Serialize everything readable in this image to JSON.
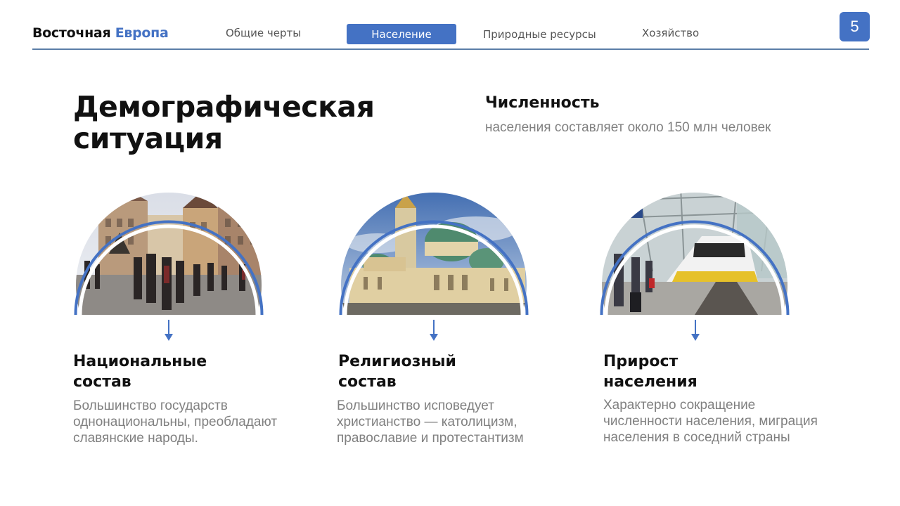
{
  "header": {
    "brand_main": "Восточная",
    "brand_accent": "Европа",
    "nav": [
      "Общие черты",
      "Население",
      "Природные ресурсы",
      "Хозяйство"
    ],
    "active_index": 1,
    "page_number": "5"
  },
  "title": {
    "line1": "Демографическая",
    "line2": "ситуация"
  },
  "stat": {
    "heading": "Численность",
    "text": "населения составляет около 150 млн человек"
  },
  "columns": [
    {
      "image": "old-town-square-photo",
      "heading1": "Национальные",
      "heading2": "состав",
      "lines": [
        "Большинство государств",
        "однонациональны, преобладают",
        "славянские народы."
      ]
    },
    {
      "image": "cathedral-photo",
      "heading1": "Религиозный",
      "heading2": "состав",
      "lines": [
        "Большинство исповедует",
        "христианство — католицизм,",
        "православие и протестантизм"
      ]
    },
    {
      "image": "train-station-photo",
      "heading1": "Прирост",
      "heading2": "населения",
      "lines": [
        "Характерно сокращение",
        "численности населения, миграция",
        "населения в соседний страны"
      ]
    }
  ],
  "colors": {
    "accent": "#4472c4",
    "text_gray": "#808080",
    "line": "#5b7ea8"
  }
}
